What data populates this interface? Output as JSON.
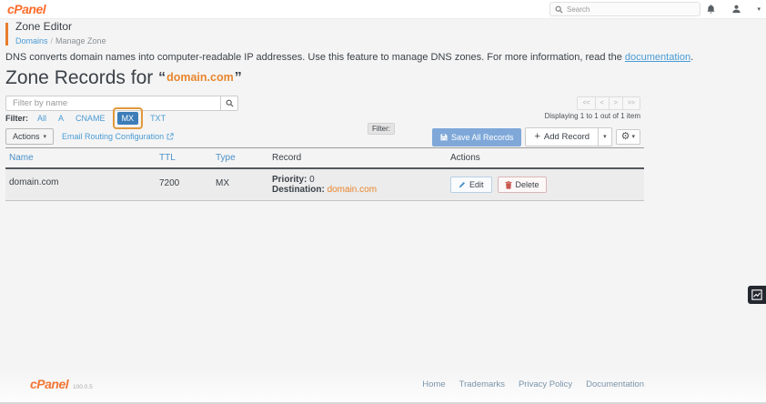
{
  "topbar": {
    "logo": "cPanel",
    "search_placeholder": "Search"
  },
  "page_header": {
    "title": "Zone Editor",
    "breadcrumb_parent": "Domains",
    "breadcrumb_sep": "/",
    "breadcrumb_current": "Manage Zone"
  },
  "description": {
    "text_before": "DNS converts domain names into computer-readable IP addresses. Use this feature to manage DNS zones. For more information, read the ",
    "link": "documentation",
    "text_after": "."
  },
  "zone_heading": {
    "prefix": "Zone Records for",
    "open_quote": "“",
    "domain": "domain.com",
    "close_quote": "”"
  },
  "toolbar": {
    "filter_placeholder": "Filter by name",
    "filter_label": "Filter:",
    "filter_options": [
      "All",
      "A",
      "CNAME",
      "MX",
      "TXT"
    ],
    "selected_filter": "MX",
    "filter_tooltip": "Filter:",
    "actions_button": "Actions",
    "email_routing_link": "Email Routing Configuration",
    "save_all_button": "Save All Records",
    "add_record_button": "Add Record"
  },
  "pagination": {
    "first": "<<",
    "prev": "<",
    "next": ">",
    "last": ">>",
    "status": "Displaying 1 to 1 out of 1 item"
  },
  "table": {
    "headers": [
      "Name",
      "TTL",
      "Type",
      "Record",
      "Actions"
    ],
    "rows": [
      {
        "name": "domain.com",
        "ttl": "7200",
        "type": "MX",
        "record": {
          "priority_label": "Priority:",
          "priority_value": "0",
          "destination_label": "Destination:",
          "destination_value": "domain.com"
        },
        "edit_label": "Edit",
        "delete_label": "Delete"
      }
    ]
  },
  "footer": {
    "logo": "cPanel",
    "version": "100.0.5",
    "links": [
      "Home",
      "Trademarks",
      "Privacy Policy",
      "Documentation"
    ]
  },
  "glyphs": {
    "caret_down": "▾",
    "gear": "⚙"
  },
  "colors": {
    "accent_orange": "#fe6d2d",
    "highlight_ring": "#e2993b",
    "link_blue": "#4a9bd5",
    "pill_blue": "#3c7db8",
    "save_button_blue": "#7fa8d9"
  }
}
